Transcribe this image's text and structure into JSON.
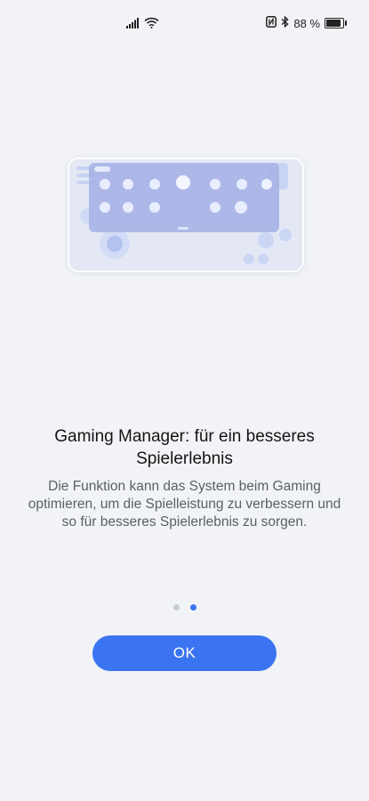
{
  "status_bar": {
    "battery_percent_label": "88 %",
    "battery_level": 0.88,
    "icons": [
      "signal-icon",
      "wifi-icon",
      "nfc-icon",
      "bluetooth-icon",
      "battery-icon"
    ]
  },
  "onboarding": {
    "title": "Gaming Manager: für ein besseres Spielerlebnis",
    "description": "Die Funktion kann das System beim Gaming optimieren, um die Spielleistung zu verbessern und so für besseres Spielerlebnis zu sorgen.",
    "page_indicator": {
      "total": 2,
      "current": 2
    },
    "ok_label": "OK"
  },
  "colors": {
    "accent": "#3b74f0",
    "background": "#f1f3f6",
    "illustration_panel": "#a9b4e6"
  }
}
